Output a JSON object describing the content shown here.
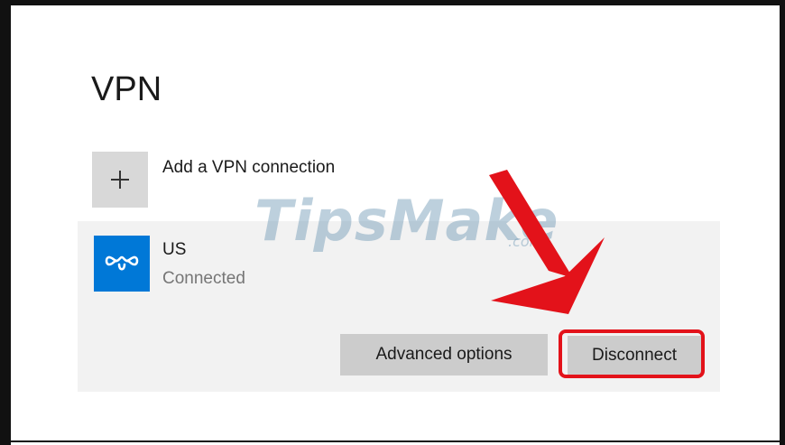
{
  "page": {
    "title": "VPN"
  },
  "add_connection": {
    "label": "Add a VPN connection",
    "icon": "plus-icon"
  },
  "connection": {
    "name": "US",
    "status": "Connected",
    "icon": "vpn-icon",
    "icon_color": "#0078d7"
  },
  "actions": {
    "advanced_label": "Advanced options",
    "disconnect_label": "Disconnect"
  },
  "annotation": {
    "highlight_color": "#e3121a",
    "arrow_icon": "red-arrow-icon"
  },
  "watermark": {
    "text": "TipsMake",
    "suffix": ".com"
  }
}
